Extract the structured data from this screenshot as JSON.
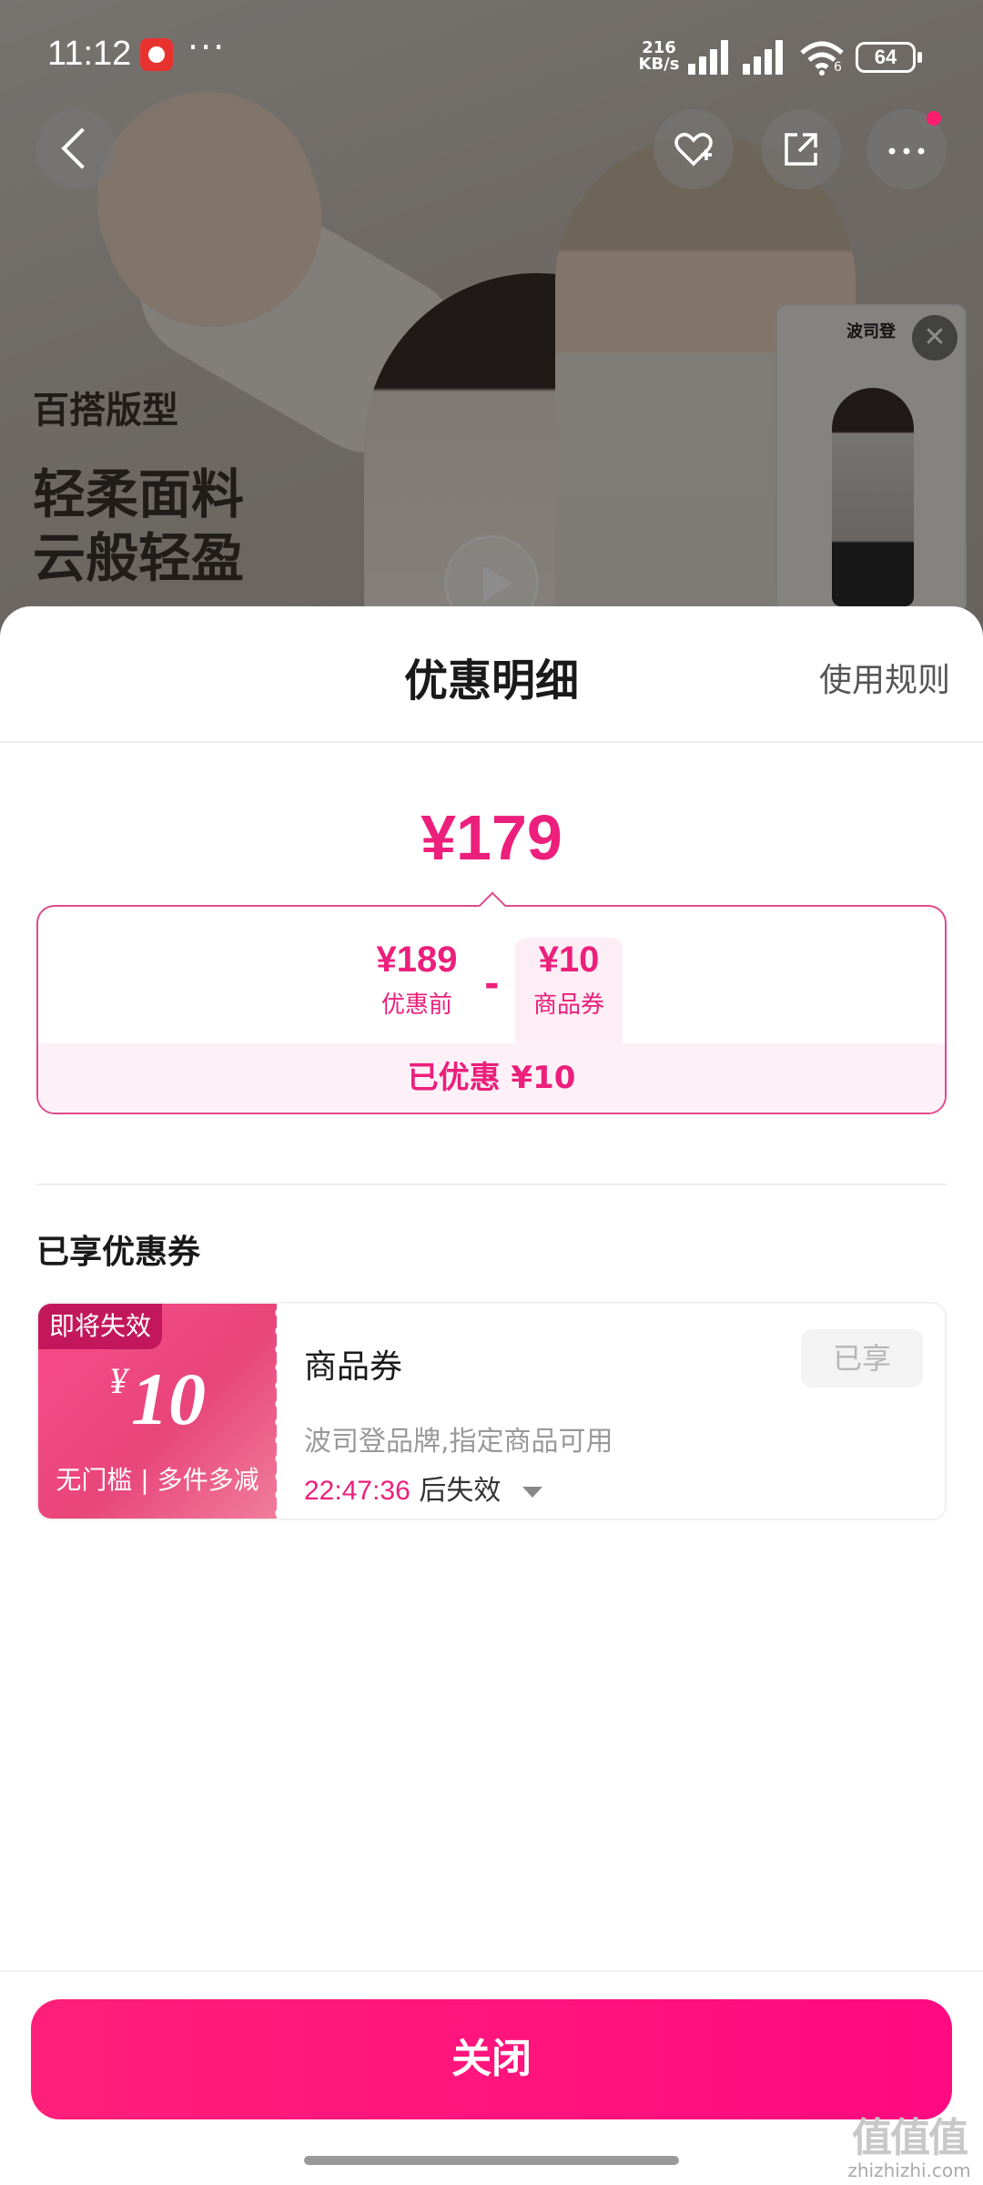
{
  "status_bar": {
    "time": "11:12",
    "more": "···",
    "net_speed_value": "216",
    "net_speed_unit": "KB/s",
    "wifi_badge": "6",
    "battery": "64"
  },
  "product_banner": {
    "promo_line1": "百搭版型",
    "promo_line2": "轻柔面料",
    "promo_line3": "云般轻盈",
    "mini_player_title": "波司登",
    "mini_close": "✕"
  },
  "sheet": {
    "title": "优惠明细",
    "rules_link": "使用规则",
    "final_price": "¥179",
    "calc": {
      "before_value": "¥189",
      "before_label": "优惠前",
      "minus": "-",
      "coupon_value": "¥10",
      "coupon_label": "商品券",
      "saved": "已优惠 ¥10"
    },
    "section_title": "已享优惠券",
    "coupon": {
      "expire_tag": "即将失效",
      "currency": "¥",
      "amount": "10",
      "conditions": "无门槛 | 多件多减",
      "name": "商品券",
      "scope": "波司登品牌,指定商品可用",
      "countdown": "22:47:36",
      "countdown_suffix": "后失效",
      "status_button": "已享"
    },
    "close_button": "关闭"
  },
  "watermark": {
    "logo": "值值值",
    "site": "zhizhizhi.com"
  },
  "colors": {
    "accent": "#ec1f7c",
    "button": "#ff1f7a",
    "coupon_gradient_start": "#f84d8a",
    "coupon_gradient_end": "#f07e9c"
  },
  "icons": [
    "back-arrow-icon",
    "heart-plus-icon",
    "share-icon",
    "more-dots-icon",
    "play-icon",
    "close-icon",
    "chevron-down-icon"
  ]
}
